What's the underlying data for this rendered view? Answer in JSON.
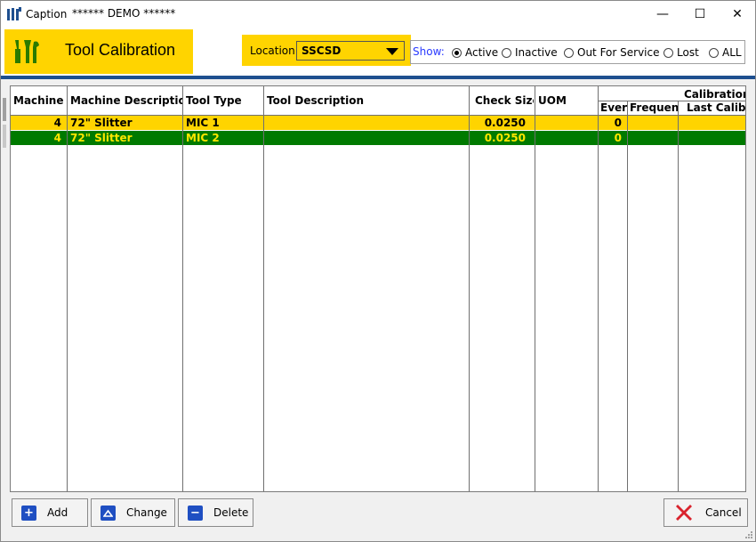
{
  "window": {
    "title": "Caption",
    "subtitle": "****** DEMO ******",
    "minimize": "—",
    "maximize": "☐",
    "close": "✕"
  },
  "header": {
    "title": "Tool Calibration",
    "brand_color": "#ffd400",
    "location_label": "Location:",
    "location_value": "SSCSD",
    "show_label": "Show:",
    "show_options": [
      {
        "label": "Active",
        "checked": true
      },
      {
        "label": "Inactive",
        "checked": false
      },
      {
        "label": "Out For Service",
        "checked": false
      },
      {
        "label": "Lost",
        "checked": false
      },
      {
        "label": "ALL",
        "checked": false
      }
    ]
  },
  "grid": {
    "columns": [
      "Machine ID",
      "Machine Description",
      "Tool Type",
      "Tool Description",
      "Check Size",
      "UOM",
      "Every",
      "Frequency",
      "Last Calib Da"
    ],
    "group_header": "Calibration",
    "rows": [
      {
        "machine_id": "4",
        "machine_desc": "72\" Slitter",
        "tool_type": "MIC 1",
        "tool_desc": "",
        "check_size": "0.0250",
        "uom": "",
        "every": "0",
        "frequency": "",
        "last_calib": ""
      },
      {
        "machine_id": "4",
        "machine_desc": "72\" Slitter",
        "tool_type": "MIC 2",
        "tool_desc": "",
        "check_size": "0.0250",
        "uom": "",
        "every": "0",
        "frequency": "",
        "last_calib": ""
      }
    ],
    "row_colors": {
      "row1": "#ffd400",
      "row2_bg": "#007a00",
      "row2_text": "#ffe600"
    }
  },
  "buttons": {
    "add": "Add",
    "change": "Change",
    "delete": "Delete",
    "cancel": "Cancel"
  }
}
